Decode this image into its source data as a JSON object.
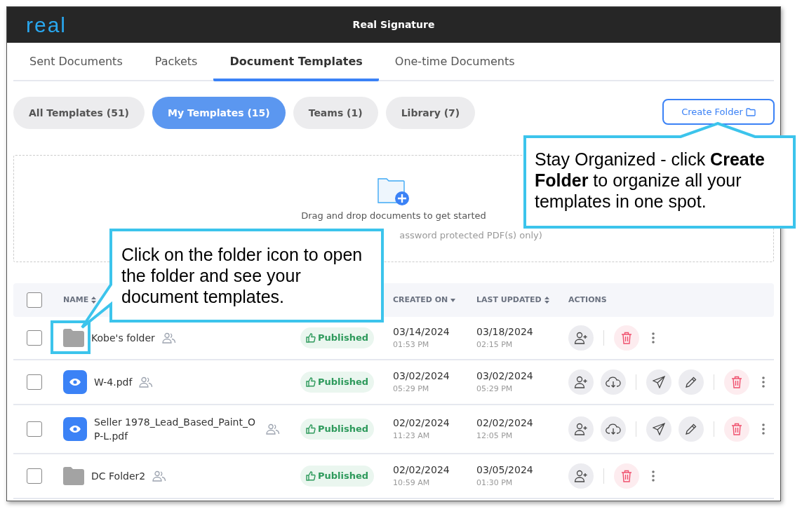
{
  "header": {
    "logo": "real",
    "title": "Real Signature"
  },
  "tabs": [
    {
      "label": "Sent Documents",
      "selected": false
    },
    {
      "label": "Packets",
      "selected": false
    },
    {
      "label": "Document Templates",
      "selected": true
    },
    {
      "label": "One-time Documents",
      "selected": false
    }
  ],
  "filters": [
    {
      "label": "All Templates (51)",
      "selected": false
    },
    {
      "label": "My Templates (15)",
      "selected": true
    },
    {
      "label": "Teams (1)",
      "selected": false
    },
    {
      "label": "Library (7)",
      "selected": false
    }
  ],
  "create_folder_button": "Create Folder",
  "dropzone": {
    "text": "Drag and drop documents to get started",
    "note": "assword protected PDF(s) only)"
  },
  "table": {
    "columns": [
      {
        "label": "NAME",
        "kind": "sortable"
      },
      {
        "label": "CREATED ON",
        "kind": "sorted"
      },
      {
        "label": "LAST UPDATED",
        "kind": "sortable"
      },
      {
        "label": "ACTIONS",
        "kind": "plain"
      }
    ],
    "header_checked": false,
    "rows": [
      {
        "kind": "folder",
        "name": "Kobe's folder",
        "checked": false,
        "status": "Published",
        "created": "03/14/2024",
        "created_time": "01:53 PM",
        "updated": "03/18/2024",
        "updated_time": "02:15 PM",
        "actions": [
          {
            "kind": "add-user"
          },
          {
            "kind": "divider"
          },
          {
            "kind": "delete"
          },
          {
            "kind": "more"
          }
        ]
      },
      {
        "kind": "file",
        "name": "W-4.pdf",
        "checked": false,
        "status": "Published",
        "created": "03/02/2024",
        "created_time": "05:29 PM",
        "updated": "03/02/2024",
        "updated_time": "05:29 PM",
        "actions": [
          {
            "kind": "add-user"
          },
          {
            "kind": "download"
          },
          {
            "kind": "divider"
          },
          {
            "kind": "send"
          },
          {
            "kind": "edit"
          },
          {
            "kind": "divider"
          },
          {
            "kind": "delete"
          },
          {
            "kind": "more"
          }
        ]
      },
      {
        "kind": "file",
        "name": "Seller 1978_Lead_Based_Paint_OP-L.pdf",
        "checked": false,
        "status": "Published",
        "created": "02/02/2024",
        "created_time": "11:23 AM",
        "updated": "02/02/2024",
        "updated_time": "12:05 PM",
        "actions": [
          {
            "kind": "add-user"
          },
          {
            "kind": "download"
          },
          {
            "kind": "divider"
          },
          {
            "kind": "send"
          },
          {
            "kind": "edit"
          },
          {
            "kind": "divider"
          },
          {
            "kind": "delete"
          },
          {
            "kind": "more"
          }
        ]
      },
      {
        "kind": "folder",
        "name": "DC Folder2",
        "checked": false,
        "status": "Published",
        "created": "02/02/2024",
        "created_time": "10:59 AM",
        "updated": "03/05/2024",
        "updated_time": "01:30 PM",
        "actions": [
          {
            "kind": "add-user"
          },
          {
            "kind": "divider"
          },
          {
            "kind": "delete"
          },
          {
            "kind": "more"
          }
        ]
      }
    ]
  },
  "callouts": [
    {
      "text": "Stay Organized - click **Create Folder** to organize all your templates in one spot."
    },
    {
      "text": "Click on the folder icon to open the folder and see your document templates."
    }
  ]
}
